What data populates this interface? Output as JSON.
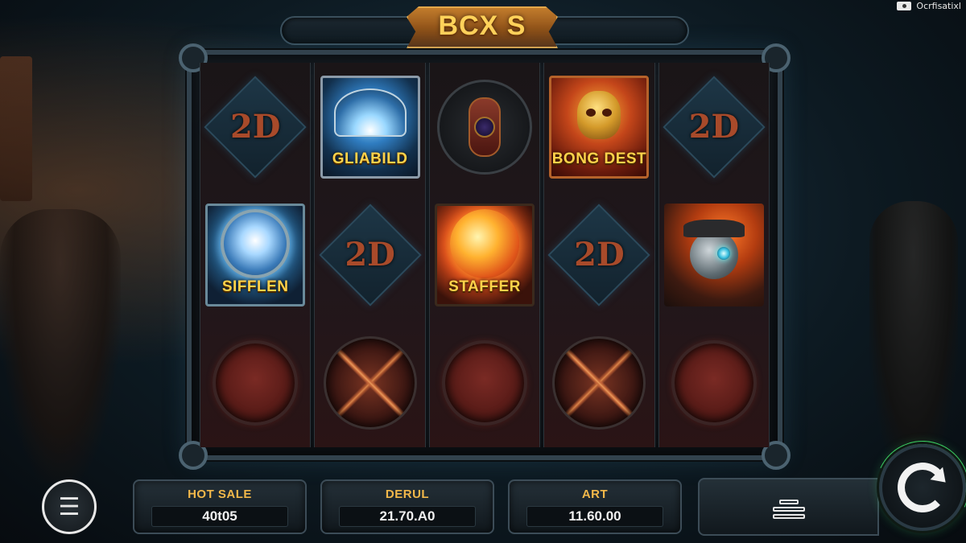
{
  "watermark": {
    "text": "Ocrfisatixl"
  },
  "title": "BCX S",
  "reels": [
    {
      "symbols": [
        {
          "kind": "diamond",
          "label": "2D"
        },
        {
          "kind": "card",
          "style": "sifflen",
          "label": "SIFFLEN",
          "art": "owl-orb"
        },
        {
          "kind": "orb-red"
        }
      ]
    },
    {
      "symbols": [
        {
          "kind": "card",
          "style": "guard",
          "label": "GLIABILD",
          "art": "fan-shape"
        },
        {
          "kind": "diamond",
          "label": "2D"
        },
        {
          "kind": "orb-burst"
        }
      ]
    },
    {
      "symbols": [
        {
          "kind": "compass"
        },
        {
          "kind": "card",
          "style": "staffer",
          "label": "STAFFER",
          "art": "sun-ball"
        },
        {
          "kind": "orb-red"
        }
      ]
    },
    {
      "symbols": [
        {
          "kind": "card",
          "style": "bong",
          "label": "BONG DEST",
          "art": "bong-skull"
        },
        {
          "kind": "diamond",
          "label": "2D"
        },
        {
          "kind": "orb-burst"
        }
      ]
    },
    {
      "symbols": [
        {
          "kind": "diamond",
          "label": "2D"
        },
        {
          "kind": "card",
          "style": "agent",
          "label": "",
          "art": "agent-head"
        },
        {
          "kind": "orb-red"
        }
      ]
    }
  ],
  "controls": {
    "menu_icon": "menu-icon",
    "hot_sale": {
      "label": "HOT SALE",
      "value": "40t05"
    },
    "derul": {
      "label": "DERUL",
      "value": "21.70.A0"
    },
    "art": {
      "label": "ART",
      "value": "11.60.00"
    },
    "bet_icon": "coin-stack-icon",
    "spin_icon": "spin-icon"
  },
  "colors": {
    "accent_gold": "#f2b84a",
    "spin_ring": "#3ccf62"
  }
}
